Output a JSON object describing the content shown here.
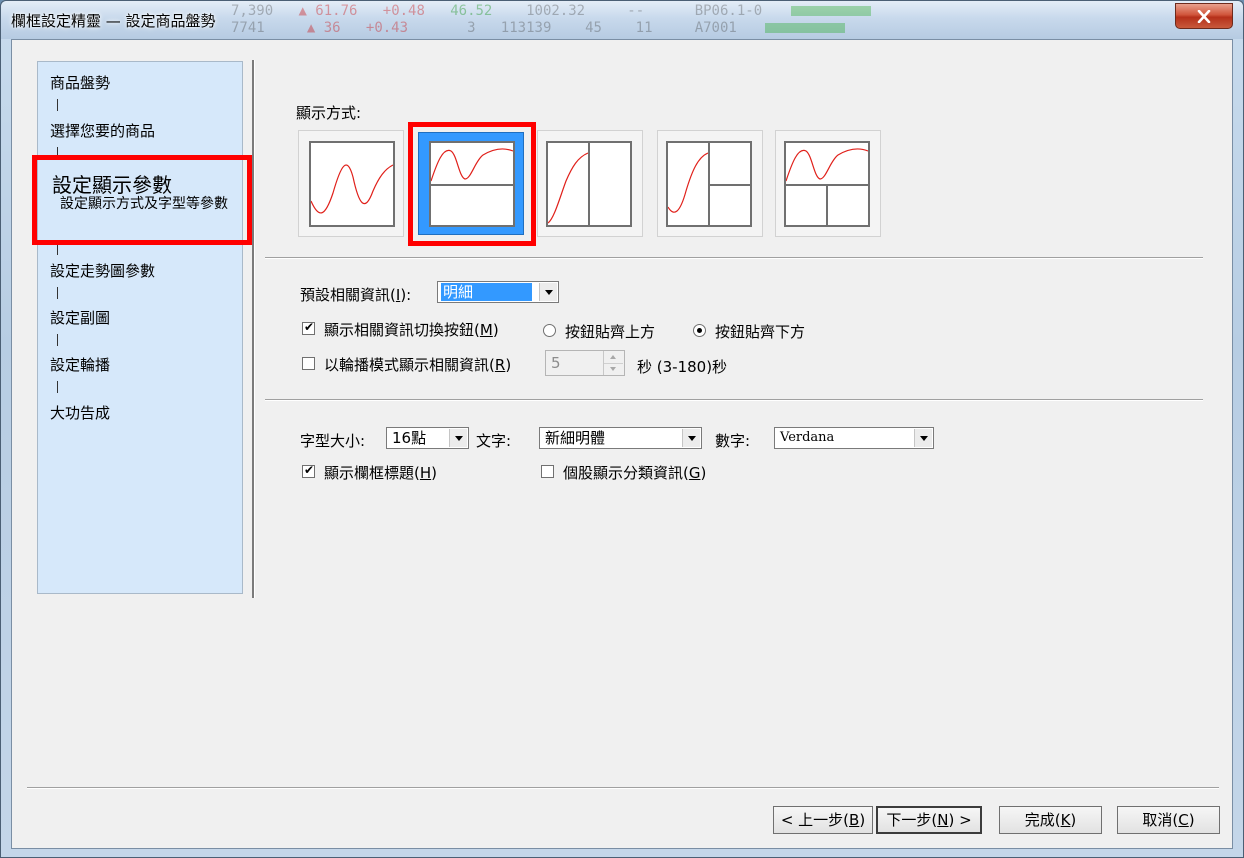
{
  "window": {
    "title": "欄框設定精靈 — 設定商品盤勢",
    "ticker_rows": [
      {
        "a": "7,390",
        "b": "▲ 61.76",
        "c": "+0.48",
        "d": "46.52",
        "e": "1002.32",
        "f": "--",
        "g": "BP06.1-0"
      },
      {
        "a": "7741",
        "b": "▲ 36",
        "c": "+0.43",
        "d": "3",
        "e": "113139",
        "f": "45",
        "g": "11",
        "h": "A7001"
      }
    ]
  },
  "steps": {
    "s1": "商品盤勢",
    "s2": "選擇您要的商品",
    "s3": "設定顯示參數",
    "s3_sub": "設定顯示方式及字型等參數",
    "s4": "設定走勢圖參數",
    "s5": "設定副圖",
    "s6": "設定輪播",
    "s7": "大功告成"
  },
  "display": {
    "label": "顯示方式:",
    "layouts": [
      "single",
      "top-bottom",
      "left-right",
      "left-right-split",
      "top-split-bottom"
    ],
    "selected_index": 1
  },
  "info": {
    "related_label": "預設相關資訊",
    "related_key": "I",
    "related_value": "明細",
    "show_switch_label": "顯示相關資訊切換按鈕",
    "show_switch_key": "M",
    "show_switch_checked": true,
    "align_top_label": "按鈕貼齊上方",
    "align_bottom_label": "按鈕貼齊下方",
    "align_selected": "bottom",
    "rotate_label": "以輪播模式顯示相關資訊",
    "rotate_key": "R",
    "rotate_checked": false,
    "rotate_seconds": "5",
    "rotate_unit": "秒 (3-180)秒"
  },
  "font": {
    "size_label": "字型大小:",
    "size_value": "16點",
    "text_label": "文字:",
    "text_value": "新細明體",
    "number_label": "數字:",
    "number_value": "Verdana",
    "show_header_label": "顯示欄框標題",
    "show_header_key": "H",
    "show_header_checked": true,
    "category_label": "個股顯示分類資訊",
    "category_key": "G",
    "category_checked": false
  },
  "buttons": {
    "prev": "< 上一步",
    "prev_key": "B",
    "next": "下一步",
    "next_key": "N",
    "next_suffix": " >",
    "finish": "完成",
    "finish_key": "K",
    "cancel": "取消",
    "cancel_key": "C"
  },
  "colors": {
    "highlight": "#ff0000",
    "selection": "#3399ff",
    "chart_line": "#e0201a"
  }
}
